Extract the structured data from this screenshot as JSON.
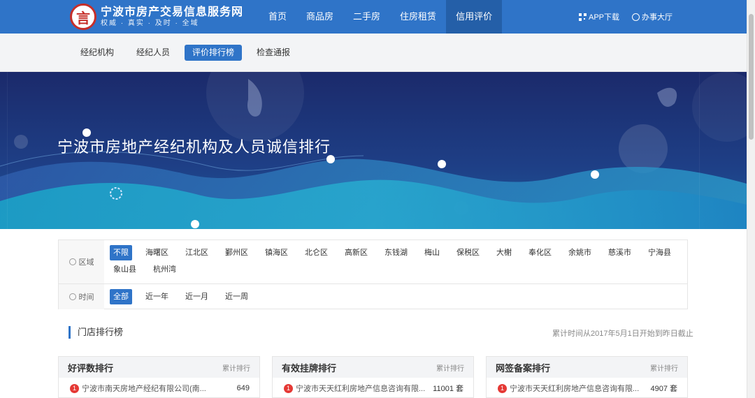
{
  "site": {
    "logo_char": "言",
    "title": "宁波市房产交易信息服务网",
    "slogan": "权威 · 真实 · 及时 · 全域"
  },
  "nav": {
    "items": [
      {
        "label": "首页",
        "active": false
      },
      {
        "label": "商品房",
        "active": false
      },
      {
        "label": "二手房",
        "active": false
      },
      {
        "label": "住房租赁",
        "active": false
      },
      {
        "label": "信用评价",
        "active": true
      }
    ],
    "app_download": "APP下载",
    "service_hall": "办事大厅"
  },
  "subnav": {
    "items": [
      {
        "label": "经纪机构",
        "active": false
      },
      {
        "label": "经纪人员",
        "active": false
      },
      {
        "label": "评价排行榜",
        "active": true
      },
      {
        "label": "检查通报",
        "active": false
      }
    ]
  },
  "banner": {
    "title": "宁波市房地产经纪机构及人员诚信排行"
  },
  "filter": {
    "region_label": "区域",
    "regions": [
      "不限",
      "海曙区",
      "江北区",
      "鄞州区",
      "镇海区",
      "北仑区",
      "高新区",
      "东钱湖",
      "梅山",
      "保税区",
      "大榭",
      "奉化区",
      "余姚市",
      "慈溪市",
      "宁海县",
      "象山县",
      "杭州湾"
    ],
    "region_selected": "不限",
    "time_label": "时间",
    "times": [
      "全部",
      "近一年",
      "近一月",
      "近一周"
    ],
    "time_selected": "全部"
  },
  "section": {
    "title": "门店排行榜",
    "note": "累计时间从2017年5月1日开始到昨日截止"
  },
  "rankings": [
    {
      "title": "好评数排行",
      "sub": "累计排行",
      "rows": [
        {
          "rank": "1",
          "name": "宁波市南天房地产经纪有限公司(南...",
          "value": "649"
        }
      ]
    },
    {
      "title": "有效挂牌排行",
      "sub": "累计排行",
      "rows": [
        {
          "rank": "1",
          "name": "宁波市天天红利房地产信息咨询有限...",
          "value": "11001 套"
        }
      ]
    },
    {
      "title": "网签备案排行",
      "sub": "累计排行",
      "rows": [
        {
          "rank": "1",
          "name": "宁波市天天红利房地产信息咨询有限...",
          "value": "4907 套"
        }
      ]
    }
  ]
}
